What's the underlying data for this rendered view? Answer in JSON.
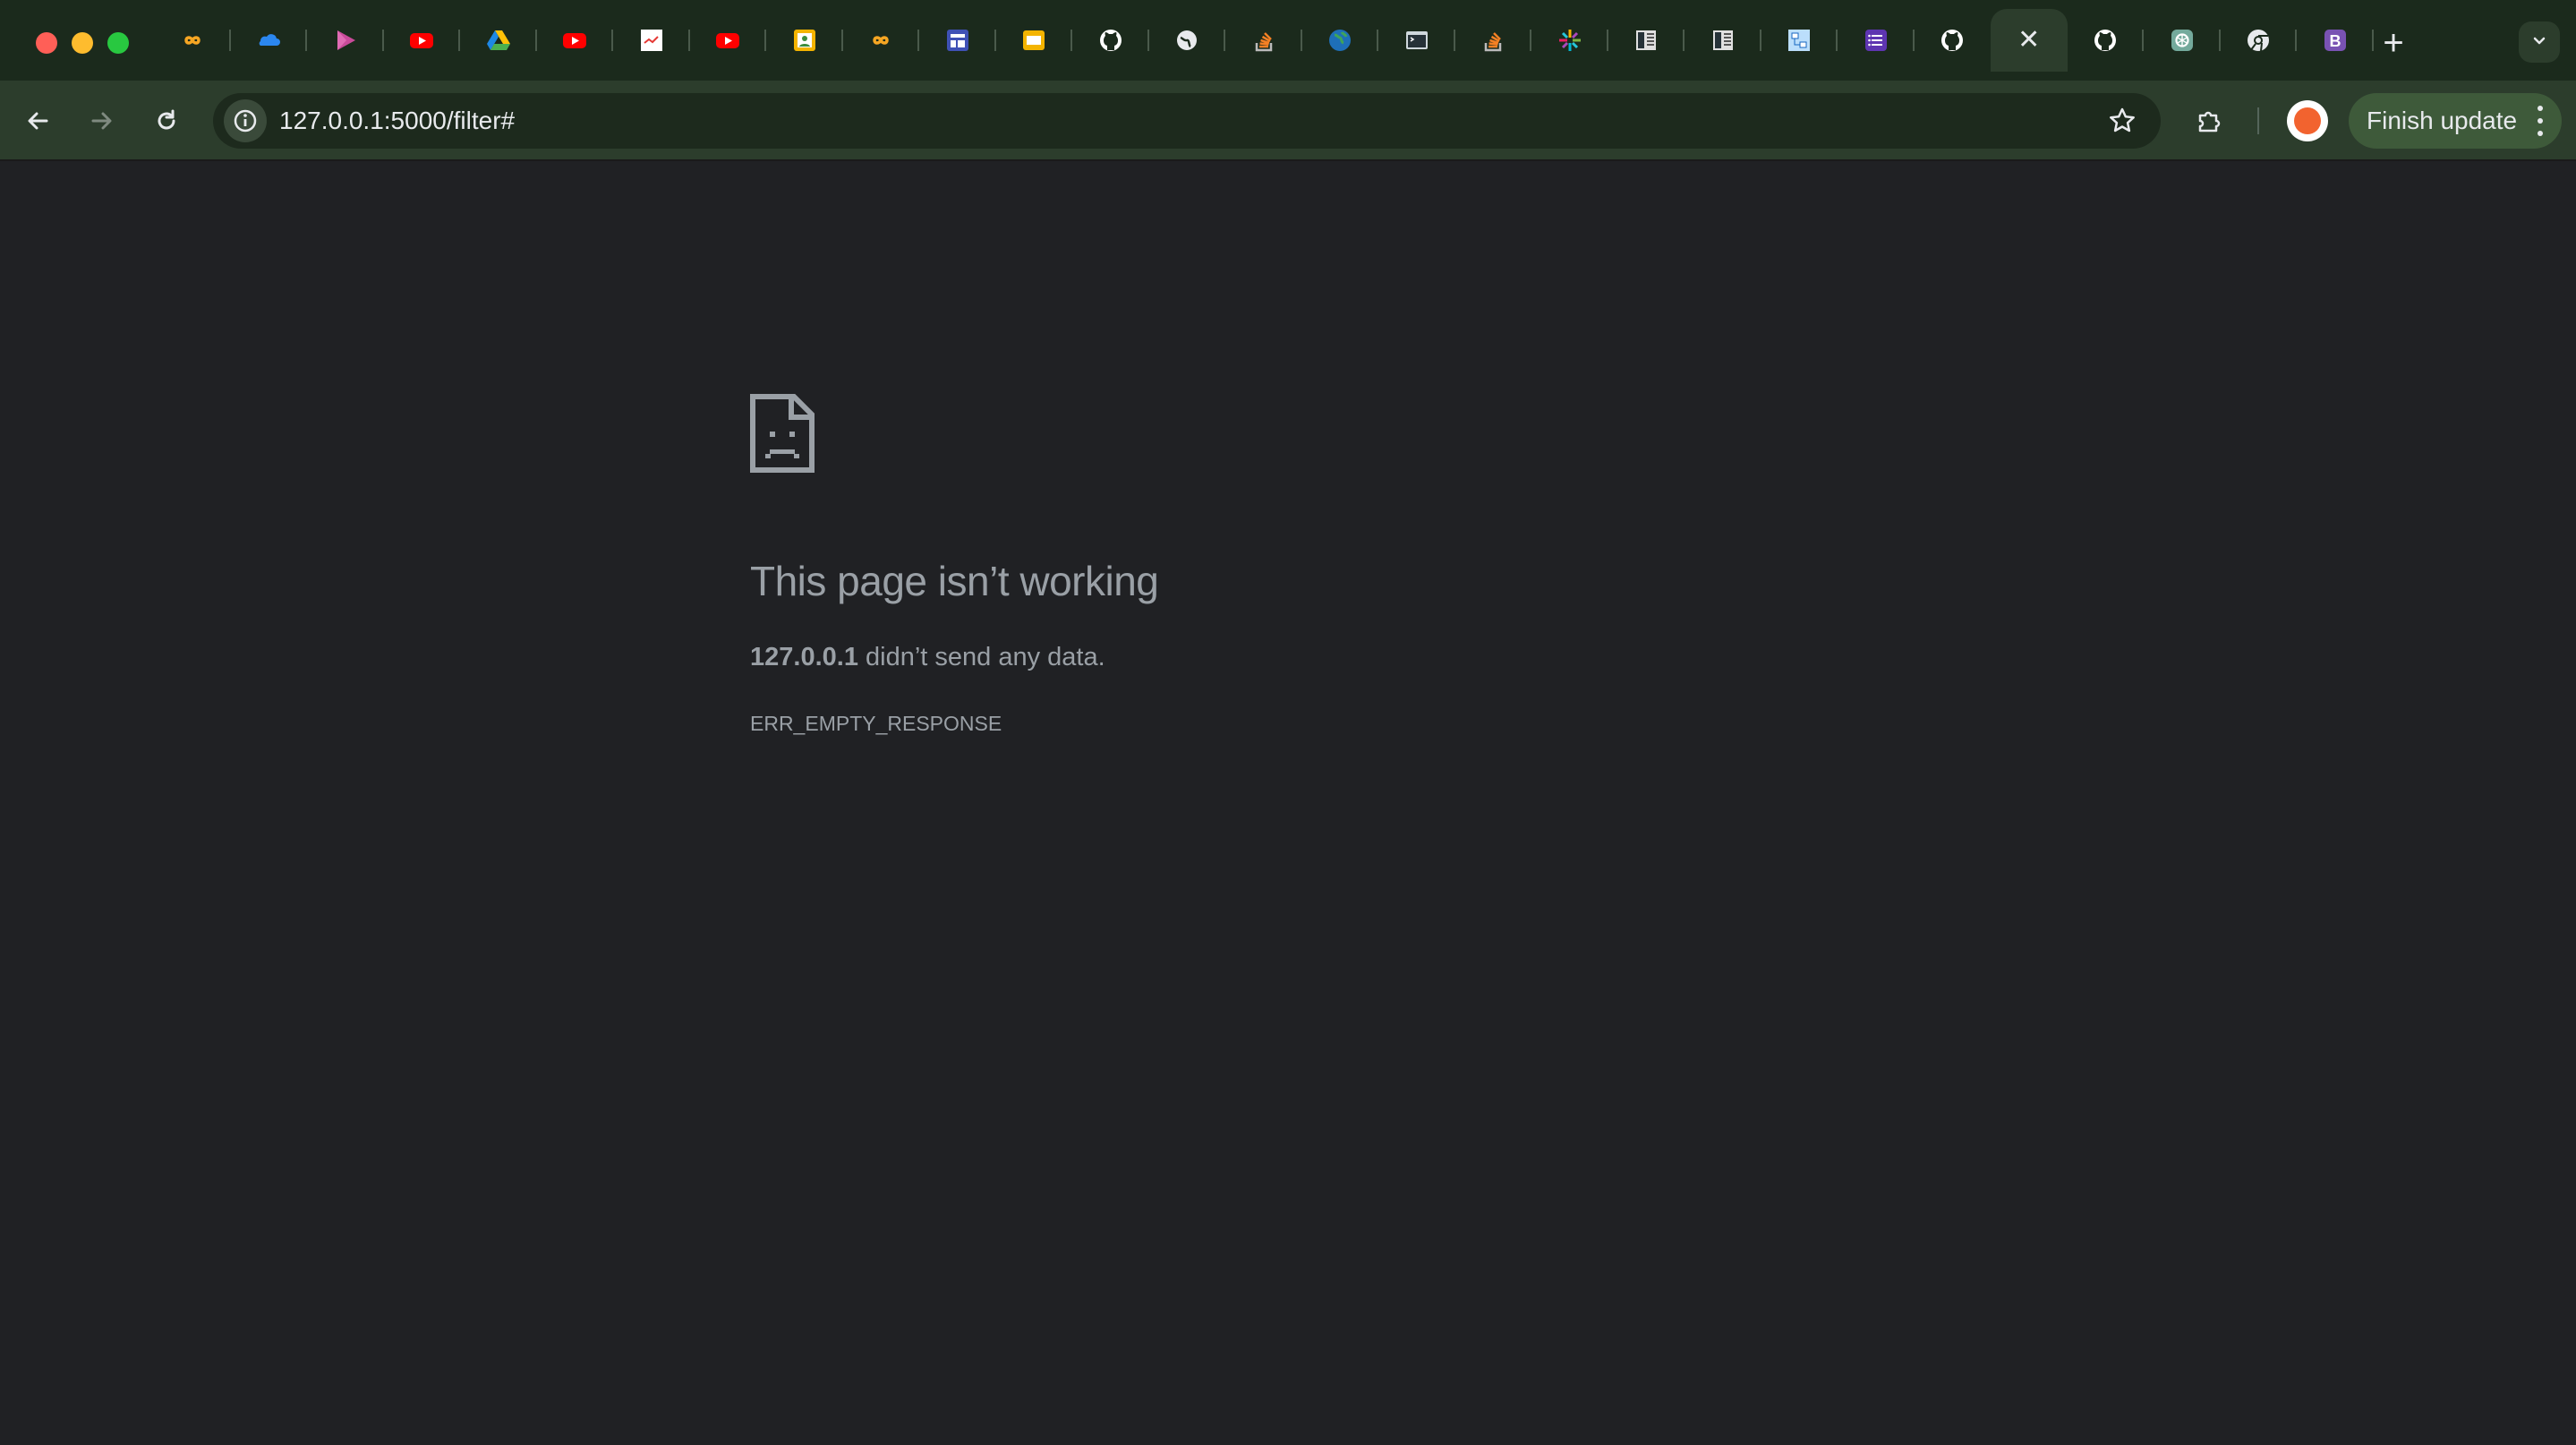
{
  "browser": {
    "tabs": [
      {
        "icon": "infinity-icon",
        "active": false
      },
      {
        "icon": "onedrive-cloud-icon",
        "active": false
      },
      {
        "icon": "play-arrow-icon",
        "active": false
      },
      {
        "icon": "youtube-icon",
        "active": false
      },
      {
        "icon": "google-drive-icon",
        "active": false
      },
      {
        "icon": "youtube-icon",
        "active": false
      },
      {
        "icon": "share-chart-icon",
        "active": false
      },
      {
        "icon": "youtube-icon",
        "active": false
      },
      {
        "icon": "image-icon",
        "active": false
      },
      {
        "icon": "infinity-icon",
        "active": false
      },
      {
        "icon": "layout-icon",
        "active": false
      },
      {
        "icon": "slides-icon",
        "active": false
      },
      {
        "icon": "github-icon",
        "active": false
      },
      {
        "icon": "globe-icon",
        "active": false
      },
      {
        "icon": "stack-overflow-icon",
        "active": false
      },
      {
        "icon": "world-icon",
        "active": false
      },
      {
        "icon": "terminal-icon",
        "active": false
      },
      {
        "icon": "stack-overflow-icon",
        "active": false
      },
      {
        "icon": "sparkle-icon",
        "active": false
      },
      {
        "icon": "book-icon",
        "active": false
      },
      {
        "icon": "book-icon",
        "active": false
      },
      {
        "icon": "diagram-icon",
        "active": false
      },
      {
        "icon": "list-icon",
        "active": false
      },
      {
        "icon": "github-icon",
        "active": false
      },
      {
        "icon": "close-icon",
        "active": true
      },
      {
        "icon": "github-icon",
        "active": false
      },
      {
        "icon": "openai-icon",
        "active": false
      },
      {
        "icon": "chrome-icon",
        "active": false
      },
      {
        "icon": "bootstrap-icon",
        "active": false
      }
    ],
    "active_tab_close": "✕",
    "new_tab_label": "+",
    "url": "127.0.0.1:5000/filter#",
    "update_button_label": "Finish update"
  },
  "error_page": {
    "title": "This page isn’t working",
    "host": "127.0.0.1",
    "description": " didn’t send any data.",
    "error_code": "ERR_EMPTY_RESPONSE"
  },
  "colors": {
    "tab_strip": "#1b2a1c",
    "toolbar": "#2c3d2c",
    "page_background": "#202124",
    "error_text": "#9aa0a6",
    "youtube": "#ff0000",
    "github": "#ffffff"
  }
}
